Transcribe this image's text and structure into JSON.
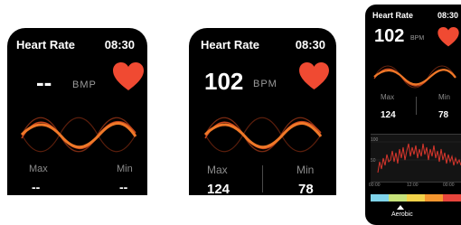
{
  "colors": {
    "background": "#000000",
    "heart": "#f04a32",
    "wave_primary": "#f07828",
    "wave_secondary": "#c8461e",
    "zones": [
      "#7fd3ea",
      "#c6e27a",
      "#f2d24a",
      "#f5962f",
      "#e8453c"
    ]
  },
  "screen_empty": {
    "title": "Heart Rate",
    "time": "08:30",
    "bpm": "--",
    "unit": "BMP",
    "max_label": "Max",
    "min_label": "Min",
    "max_value": "--",
    "min_value": "--",
    "icon": "heart-icon"
  },
  "screen_reading": {
    "title": "Heart Rate",
    "time": "08:30",
    "bpm": "102",
    "unit": "BPM",
    "max_label": "Max",
    "min_label": "Min",
    "max_value": "124",
    "min_value": "78",
    "icon": "heart-icon"
  },
  "screen_detail": {
    "title": "Heart Rate",
    "time": "08:30",
    "bpm": "102",
    "unit": "BPM",
    "max_label": "Max",
    "min_label": "Min",
    "max_value": "124",
    "min_value": "78",
    "chart_y_labels": [
      "100",
      "50"
    ],
    "chart_x_labels": [
      "00:00",
      "12:00",
      "00:00"
    ],
    "zone_label": "Aerobic",
    "icon": "heart-icon"
  }
}
